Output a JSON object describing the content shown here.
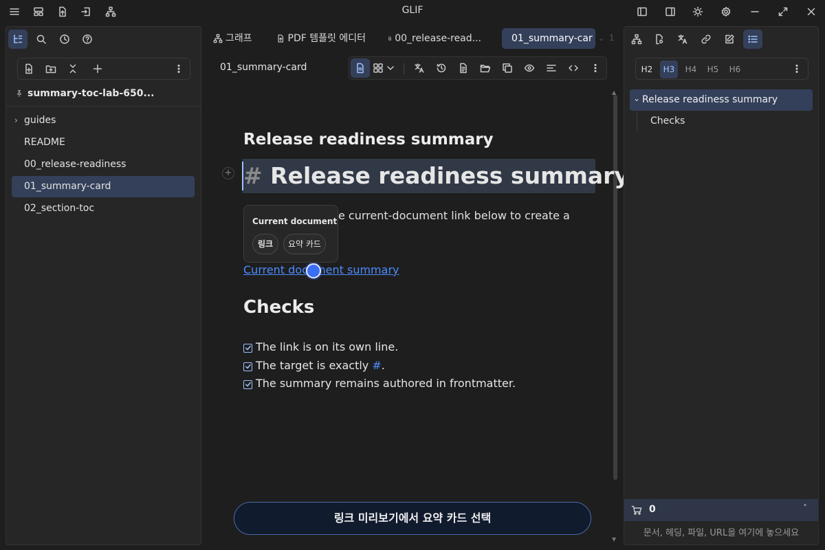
{
  "app": {
    "title": "GLIF"
  },
  "titlebar": {
    "left_icons": [
      "menu-icon",
      "layout-icon",
      "file-upload-icon",
      "login-icon",
      "sitemap-icon"
    ],
    "right_icons": [
      "left-sidebar-icon",
      "right-sidebar-icon",
      "sun-icon",
      "settings-icon",
      "minimize-icon",
      "maximize-icon",
      "close-icon"
    ]
  },
  "sidebar": {
    "vault_name": "summary-toc-lab-650...",
    "items": [
      {
        "label": "guides",
        "folder": true
      },
      {
        "label": "README"
      },
      {
        "label": "00_release-readiness"
      },
      {
        "label": "01_summary-card",
        "selected": true
      },
      {
        "label": "02_section-toc"
      }
    ]
  },
  "tabs": [
    {
      "label": "그래프",
      "icon": "graph-icon"
    },
    {
      "label": "PDF 템플릿 에디터",
      "icon": "file-export-icon"
    },
    {
      "label": "00_release-read...",
      "icon": "document-icon"
    },
    {
      "label": "01_summary-car",
      "icon": "document-icon",
      "active": true
    }
  ],
  "tab_overflow": "1",
  "editor": {
    "filename": "01_summary-card",
    "frontmatter_title": "Release readiness summary",
    "h1_marker": "#",
    "h1": "Release readiness summary",
    "paragraph_visible": "e current-document link below to create a",
    "link_text": "Current document summary",
    "h2": "Checks",
    "checks": [
      {
        "before": "The link is on its own line.",
        "code": "",
        "after": ""
      },
      {
        "before": "The target is exactly ",
        "code": "#",
        "after": "."
      },
      {
        "before": "The summary remains authored in frontmatter.",
        "code": "",
        "after": ""
      }
    ]
  },
  "popup": {
    "title": "Current document",
    "options": [
      "링크",
      "요약 카드"
    ]
  },
  "action_button": {
    "label": "링크 미리보기에서 요약 카드 선택"
  },
  "outline": {
    "heading_buttons": [
      "H2",
      "H3",
      "H4",
      "H5",
      "H6"
    ],
    "active_heading": "H3",
    "items": [
      {
        "label": "Release readiness summary",
        "level": 1,
        "active": true
      },
      {
        "label": "Checks",
        "level": 2
      }
    ]
  },
  "cart": {
    "count": "0",
    "dropzone_placeholder": "문서, 헤딩, 파일, URL을 여기에 놓으세요"
  },
  "colors": {
    "accent": "#4d8cff",
    "selection": "#34405a",
    "background": "#1e1e1e",
    "panel": "#262626"
  }
}
